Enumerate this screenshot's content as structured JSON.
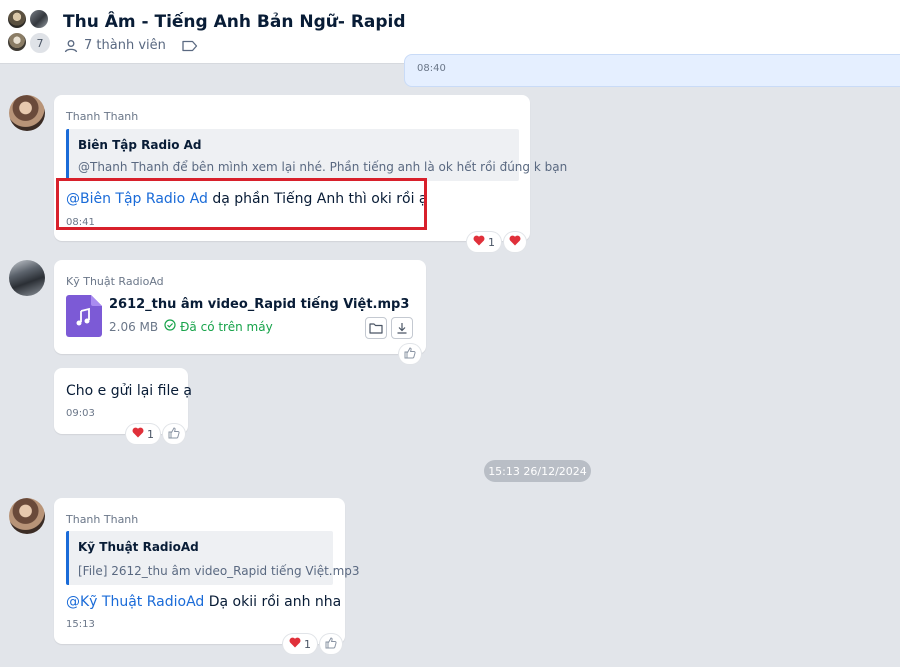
{
  "header": {
    "title": "Thu Âm - Tiếng Anh Bản Ngữ- Rapid",
    "member_count_badge": "7",
    "members": "7 thành viên"
  },
  "messages": {
    "mine_time": "08:40",
    "m1": {
      "sender": "Thanh Thanh",
      "quote_name": "Biên Tập Radio Ad",
      "quote_text": "@Thanh Thanh để bên mình xem lại nhé. Phần tiếng anh là ok hết rồi đúng k bạn",
      "mention": "@Biên Tập Radio Ad",
      "text": " dạ phần Tiếng Anh thì oki rồi ạ",
      "time": "08:41",
      "reaction_count": "1"
    },
    "m2": {
      "sender": "Kỹ Thuật RadioAd",
      "file_name": "2612_thu âm video_Rapid tiếng Việt.mp3",
      "file_size": "2.06 MB",
      "file_status": "Đã có trên máy"
    },
    "m3": {
      "text": "Cho e gửi lại file ạ",
      "time": "09:03",
      "reaction_count": "1"
    },
    "date_separator": "15:13 26/12/2024",
    "m4": {
      "sender": "Thanh Thanh",
      "quote_name": "Kỹ Thuật RadioAd",
      "quote_text": "[File] 2612_thu âm video_Rapid tiếng Việt.mp3",
      "mention": "@Kỹ Thuật RadioAd",
      "text": " Dạ okii rồi anh nha",
      "time": "15:13",
      "reaction_count": "1"
    }
  },
  "colors": {
    "accent": "#1a6bd8",
    "highlight_box": "#d8202b",
    "heart": "#e0303a",
    "file_icon": "#7c5ad6",
    "status_ok": "#17a34a"
  },
  "icons": {
    "members": "person-icon",
    "label": "tag-icon",
    "file": "music-file-icon",
    "folder": "folder-icon",
    "download": "download-icon",
    "heart": "heart-icon",
    "like": "thumbs-up-icon",
    "check": "check-circle-icon"
  }
}
